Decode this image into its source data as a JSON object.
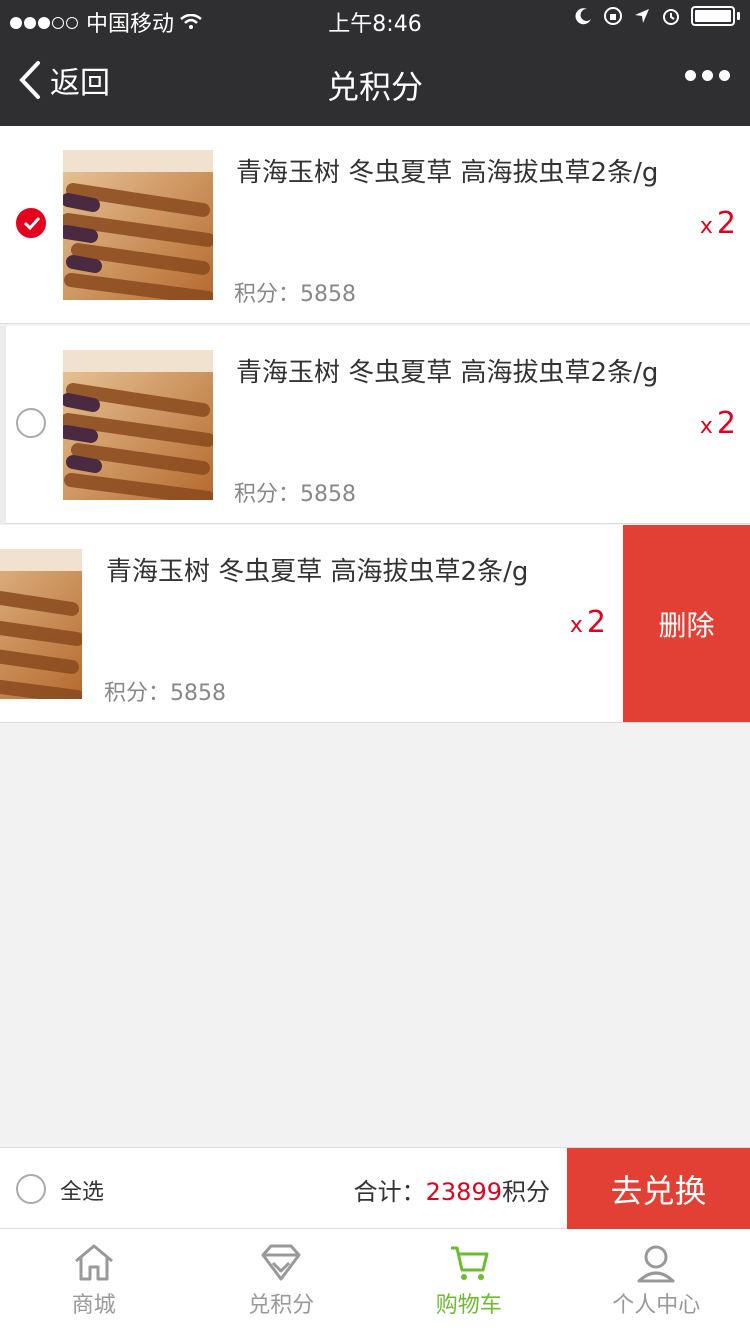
{
  "status_bar": {
    "carrier": "中国移动",
    "time": "上午8:46"
  },
  "nav": {
    "back_label": "返回",
    "title": "兑积分"
  },
  "items": [
    {
      "name": "青海玉树 冬虫夏草 高海拔虫草2条/g",
      "qty_x": "x",
      "qty": "2",
      "points_label": "积分：",
      "points": "5858",
      "checked": true
    },
    {
      "name": "青海玉树 冬虫夏草 高海拔虫草2条/g",
      "qty_x": "x",
      "qty": "2",
      "points_label": "积分：",
      "points": "5858",
      "checked": false
    },
    {
      "name": "青海玉树 冬虫夏草 高海拔虫草2条/g",
      "qty_x": "x",
      "qty": "2",
      "points_label": "积分：",
      "points": "5858",
      "checked": false,
      "delete_label": "删除"
    }
  ],
  "checkout": {
    "select_all": "全选",
    "total_label": "合计：",
    "total_value": "23899",
    "total_unit": "积分",
    "redeem_label": "去兑换"
  },
  "tabs": [
    {
      "label": "商城",
      "icon": "home-icon"
    },
    {
      "label": "兑积分",
      "icon": "diamond-icon"
    },
    {
      "label": "购物车",
      "icon": "cart-icon",
      "active": true
    },
    {
      "label": "个人中心",
      "icon": "user-icon"
    }
  ],
  "colors": {
    "accent_red": "#e23f35",
    "price_red": "#e4001e",
    "active_green": "#6cbd2e",
    "nav_bg": "#2f2f31"
  }
}
